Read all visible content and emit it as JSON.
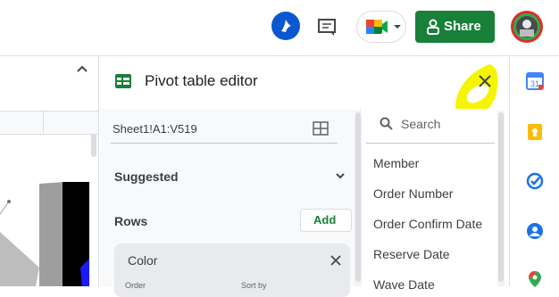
{
  "header": {
    "share_label": "Share"
  },
  "sheet": {
    "collapse_icon": "chevron-up-icon"
  },
  "panel": {
    "title": "Pivot table editor",
    "range": "Sheet1!A1:V519",
    "suggested_label": "Suggested",
    "rows_label": "Rows",
    "add_label": "Add",
    "row_card": {
      "label": "Color",
      "order_label": "Order",
      "sort_label": "Sort by"
    },
    "search_placeholder": "Search",
    "fields": [
      "Member",
      "Order Number",
      "Order Confirm Date",
      "Reserve Date",
      "Wave Date"
    ]
  },
  "colors": {
    "accent": "#188038",
    "highlight": "#f5f500",
    "brand_blue": "#0b57d0"
  },
  "side_icons": [
    "calendar-icon",
    "keep-icon",
    "tasks-icon",
    "contacts-icon",
    "maps-icon"
  ]
}
